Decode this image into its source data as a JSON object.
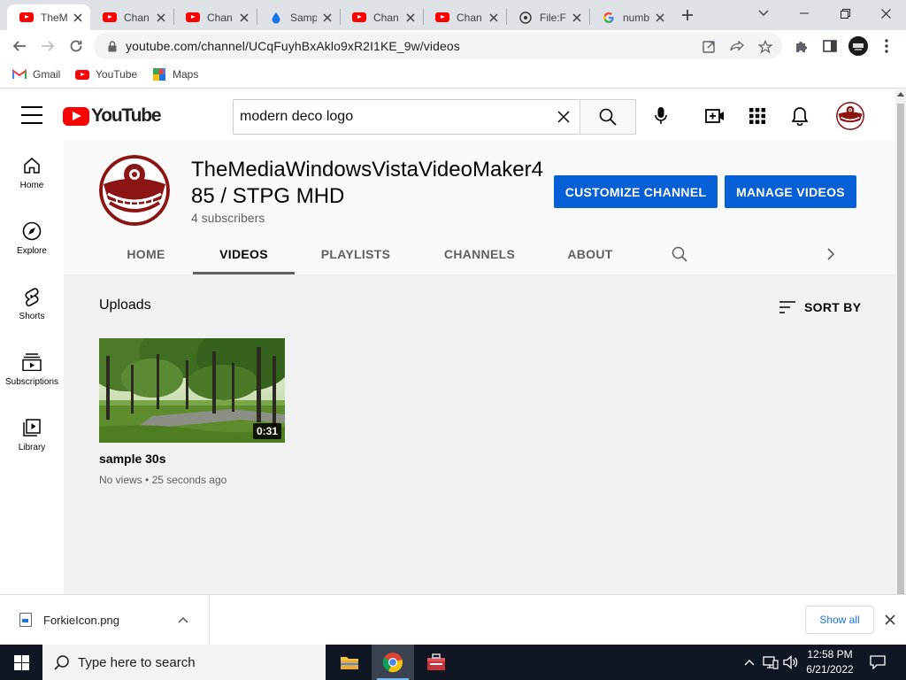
{
  "browser": {
    "tabs": [
      {
        "title": "TheM",
        "favicon": "youtube-icon",
        "active": true
      },
      {
        "title": "Chan",
        "favicon": "youtube-icon",
        "active": false
      },
      {
        "title": "Chan",
        "favicon": "youtube-icon",
        "active": false
      },
      {
        "title": "Samp",
        "favicon": "drop-icon",
        "active": false
      },
      {
        "title": "Chan",
        "favicon": "youtube-icon",
        "active": false
      },
      {
        "title": "Chan",
        "favicon": "youtube-icon",
        "active": false
      },
      {
        "title": "File:F",
        "favicon": "wikimedia-icon",
        "active": false
      },
      {
        "title": "numb",
        "favicon": "google-icon",
        "active": false
      }
    ],
    "url": "youtube.com/channel/UCqFuyhBxAklo9xR2I1KE_9w/videos",
    "bookmarks": [
      {
        "label": "Gmail",
        "icon": "gmail-icon"
      },
      {
        "label": "YouTube",
        "icon": "youtube-icon"
      },
      {
        "label": "Maps",
        "icon": "maps-icon"
      }
    ]
  },
  "youtube": {
    "logo_text": "YouTube",
    "search_value": "modern deco logo",
    "guide": [
      {
        "label": "Home",
        "icon": "home-icon"
      },
      {
        "label": "Explore",
        "icon": "compass-icon"
      },
      {
        "label": "Shorts",
        "icon": "shorts-icon"
      },
      {
        "label": "Subscriptions",
        "icon": "subscriptions-icon"
      },
      {
        "label": "Library",
        "icon": "library-icon"
      }
    ],
    "channel": {
      "name": "TheMediaWindowsVistaVideoMaker485 / STPG MHD",
      "subscribers": "4 subscribers",
      "customize_label": "CUSTOMIZE CHANNEL",
      "manage_label": "MANAGE VIDEOS",
      "tabs": [
        "HOME",
        "VIDEOS",
        "PLAYLISTS",
        "CHANNELS",
        "ABOUT"
      ],
      "selected_tab": "VIDEOS"
    },
    "uploads_heading": "Uploads",
    "sort_label": "SORT BY",
    "videos": [
      {
        "title": "sample 30s",
        "duration": "0:31",
        "views": "No views",
        "age": "25 seconds ago"
      }
    ]
  },
  "downloads": {
    "file": "ForkieIcon.png",
    "show_all": "Show all"
  },
  "taskbar": {
    "search_placeholder": "Type here to search",
    "time": "12:58 PM",
    "date": "6/21/2022"
  },
  "colors": {
    "accent_blue": "#065fd4",
    "youtube_red": "#ff0000",
    "logo_maroon": "#8b1414"
  }
}
